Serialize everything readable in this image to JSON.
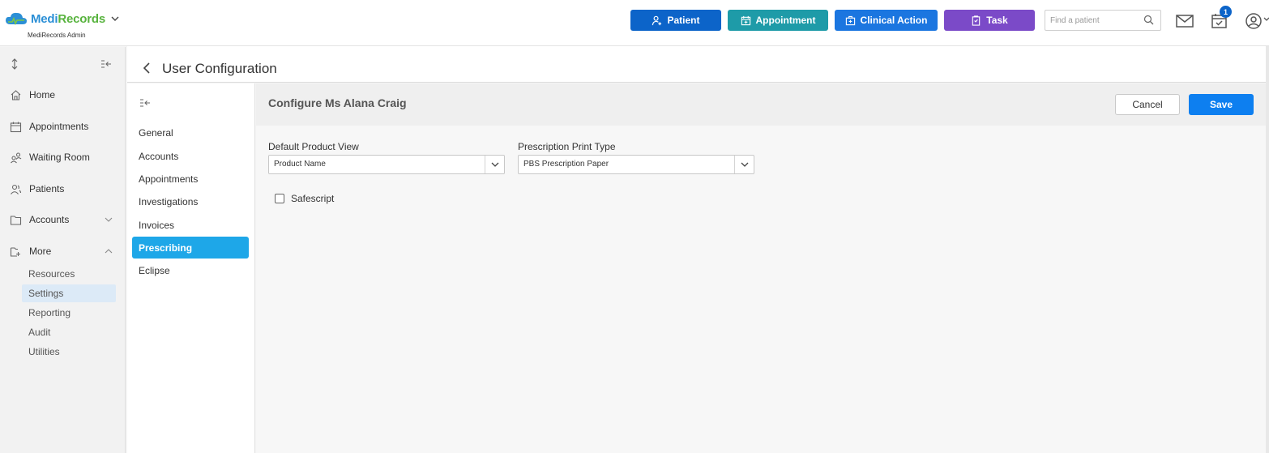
{
  "brand": {
    "name_part1": "Medi",
    "name_part2": "Records",
    "subtitle": "MediRecords Admin"
  },
  "header": {
    "buttons": {
      "patient": "Patient",
      "appointment": "Appointment",
      "clinical_action": "Clinical Action",
      "task": "Task"
    },
    "search_placeholder": "Find a patient",
    "notification_count": "1"
  },
  "sidebar": {
    "items": [
      {
        "label": "Home",
        "icon": "home-icon"
      },
      {
        "label": "Appointments",
        "icon": "calendar-icon"
      },
      {
        "label": "Waiting Room",
        "icon": "waiting-room-icon"
      },
      {
        "label": "Patients",
        "icon": "patients-icon"
      },
      {
        "label": "Accounts",
        "icon": "folder-icon"
      },
      {
        "label": "More",
        "icon": "folder-plus-icon"
      }
    ],
    "more_items": [
      "Resources",
      "Settings",
      "Reporting",
      "Audit",
      "Utilities"
    ]
  },
  "page": {
    "title": "User Configuration"
  },
  "subnav": {
    "items": [
      "General",
      "Accounts",
      "Appointments",
      "Investigations",
      "Invoices",
      "Prescribing",
      "Eclipse"
    ]
  },
  "content": {
    "title": "Configure Ms Alana Craig",
    "cancel_label": "Cancel",
    "save_label": "Save",
    "fields": {
      "default_product_view": {
        "label": "Default Product View",
        "value": "Product Name"
      },
      "prescription_print_type": {
        "label": "Prescription Print Type",
        "value": "PBS Prescription Paper"
      }
    },
    "safescript_label": "Safescript"
  },
  "colors": {
    "patient_btn": "#0c64c9",
    "appointment_btn": "#1e9ba8",
    "clinical_btn": "#1b76e0",
    "task_btn": "#7b4ac8",
    "active_subnav": "#1ea7e8",
    "save_btn": "#0d7ff0"
  }
}
